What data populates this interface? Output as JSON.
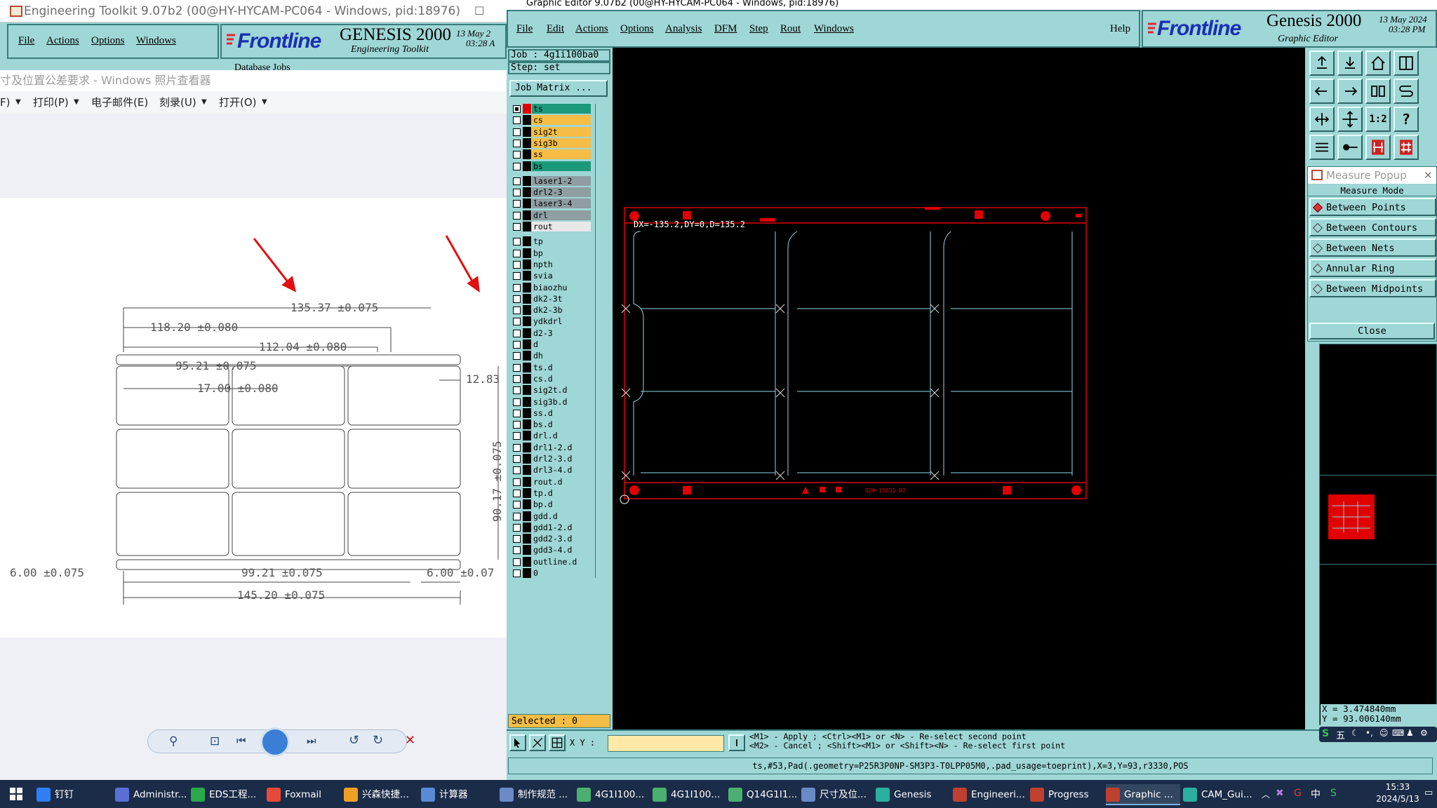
{
  "toolkit": {
    "title": "Engineering Toolkit 9.07b2 (00@HY-HYCAM-PC064 - Windows, pid:18976)",
    "menu": [
      "File",
      "Actions",
      "Options",
      "Windows"
    ],
    "brand": "Frontline",
    "genesis": "GENESIS 2000",
    "date": "13 May 2",
    "time": "03:28 A",
    "subtitle": "Engineering Toolkit",
    "database_jobs": "Database Jobs"
  },
  "viewer": {
    "title": "寸及位置公差要求 - Windows 照片查看器",
    "menu": [
      {
        "label": "F)"
      },
      {
        "label": "打印(P)"
      },
      {
        "label": "电子邮件(E)"
      },
      {
        "label": "刻录(U)"
      },
      {
        "label": "打开(O)"
      }
    ],
    "drawing": {
      "dims": [
        "135.37 ±0.075",
        "118.20 ±0.080",
        "112.04 ±0.080",
        "95.21 ±0.075",
        "17.00 ±0.080",
        "12.83",
        "90.17 ±0.075",
        "6.00 ±0.075",
        "99.21 ±0.075",
        "6.00 ±0.07",
        "145.20 ±0.075"
      ]
    }
  },
  "editor": {
    "title": "Graphic Editor 9.07b2 (00@HY-HYCAM-PC064 - Windows, pid:18976)",
    "menu": [
      "File",
      "Edit",
      "Actions",
      "Options",
      "Analysis",
      "DFM",
      "Step",
      "Rout",
      "Windows"
    ],
    "help": "Help",
    "brand": "Frontline",
    "genesis": "Genesis 2000",
    "date": "13 May 2024",
    "time": "03:28 PM",
    "subtitle": "Graphic Editor",
    "job_label": "Job : 4g1i100ba0",
    "step_label": "Step: set",
    "job_matrix": "Job Matrix ...",
    "layers": [
      {
        "name": "ts",
        "color": "#1a9a7a"
      },
      {
        "name": "cs",
        "color": "#f5bd45"
      },
      {
        "name": "sig2t",
        "color": "#f5bd45"
      },
      {
        "name": "sig3b",
        "color": "#f5bd45"
      },
      {
        "name": "ss",
        "color": "#f5bd45"
      },
      {
        "name": "bs",
        "color": "#1a9a7a"
      },
      {
        "name": "laser1-2",
        "color": "#8e9ea3"
      },
      {
        "name": "drl2-3",
        "color": "#8e9ea3"
      },
      {
        "name": "laser3-4",
        "color": "#8e9ea3"
      },
      {
        "name": "drl",
        "color": "#8e9ea3"
      },
      {
        "name": "rout",
        "color": "#e8e8e8"
      },
      {
        "name": "tp",
        "color": "#9fd6d6"
      },
      {
        "name": "bp",
        "color": "#9fd6d6"
      },
      {
        "name": "npth",
        "color": "#9fd6d6"
      },
      {
        "name": "svia",
        "color": "#9fd6d6"
      },
      {
        "name": "biaozhu",
        "color": "#9fd6d6"
      },
      {
        "name": "dk2-3t",
        "color": "#9fd6d6"
      },
      {
        "name": "dk2-3b",
        "color": "#9fd6d6"
      },
      {
        "name": "ydkdrl",
        "color": "#9fd6d6"
      },
      {
        "name": "d2-3",
        "color": "#9fd6d6"
      },
      {
        "name": "d",
        "color": "#9fd6d6"
      },
      {
        "name": "dh",
        "color": "#9fd6d6"
      },
      {
        "name": "ts.d",
        "color": "#9fd6d6"
      },
      {
        "name": "cs.d",
        "color": "#9fd6d6"
      },
      {
        "name": "sig2t.d",
        "color": "#9fd6d6"
      },
      {
        "name": "sig3b.d",
        "color": "#9fd6d6"
      },
      {
        "name": "ss.d",
        "color": "#9fd6d6"
      },
      {
        "name": "bs.d",
        "color": "#9fd6d6"
      },
      {
        "name": "drl.d",
        "color": "#9fd6d6"
      },
      {
        "name": "drl1-2.d",
        "color": "#9fd6d6"
      },
      {
        "name": "drl2-3.d",
        "color": "#9fd6d6"
      },
      {
        "name": "drl3-4.d",
        "color": "#9fd6d6"
      },
      {
        "name": "rout.d",
        "color": "#9fd6d6"
      },
      {
        "name": "tp.d",
        "color": "#9fd6d6"
      },
      {
        "name": "bp.d",
        "color": "#9fd6d6"
      },
      {
        "name": "gdd.d",
        "color": "#9fd6d6"
      },
      {
        "name": "gdd1-2.d",
        "color": "#9fd6d6"
      },
      {
        "name": "gdd2-3.d",
        "color": "#9fd6d6"
      },
      {
        "name": "gdd3-4.d",
        "color": "#9fd6d6"
      },
      {
        "name": "outline.d",
        "color": "#9fd6d6"
      },
      {
        "name": "0",
        "color": "#9fd6d6"
      }
    ],
    "selected": "Selected : 0",
    "canvas_readout": "DX=-135.2,DY=0,D=135.2",
    "panel_text": "920-15631-02",
    "xy_label": "X Y :",
    "hint1": "<M1> - Apply  ; <Ctrl><M1> or <N> - Re-select second point",
    "hint2": "<M2> - Cancel ; <Shift><M1> or <Shift><N> - Re-select first point",
    "status": "ts,#53,Pad(.geometry=P25R3P0NP-SM3P3-T0LPP05M0,.pad_usage=toeprint),X=3,Y=93,r3330,POS",
    "coord_x": "X = 3.474840mm",
    "coord_y": "Y = 93.006140mm",
    "measure": {
      "title": "Measure Popup",
      "mode": "Measure Mode",
      "items": [
        "Between Points",
        "Between Contours",
        "Between Nets",
        "Annular Ring",
        "Between Midpoints"
      ],
      "close": "Close"
    }
  },
  "taskbar": {
    "items": [
      {
        "label": "钉钉",
        "color": "#2f7ef5"
      },
      {
        "label": "Administr...",
        "color": "#5a6fd6"
      },
      {
        "label": "EDS工程...",
        "color": "#2aa84a"
      },
      {
        "label": "Foxmail",
        "color": "#e84a3a"
      },
      {
        "label": "兴森快捷...",
        "color": "#f0a020"
      },
      {
        "label": "计算器",
        "color": "#5a8ad6"
      },
      {
        "label": "制作规范 ...",
        "color": "#6a8ac6"
      },
      {
        "label": "4G1I100...",
        "color": "#4ab070"
      },
      {
        "label": "4G1I100...",
        "color": "#4ab070"
      },
      {
        "label": "Q14G1I1...",
        "color": "#4ab070"
      },
      {
        "label": "尺寸及位...",
        "color": "#6a8ac6"
      },
      {
        "label": "Genesis",
        "color": "#2ab0a0"
      },
      {
        "label": "Engineeri...",
        "color": "#c04030"
      },
      {
        "label": "Progress",
        "color": "#c04030"
      },
      {
        "label": "Graphic ...",
        "color": "#c04030"
      },
      {
        "label": "CAM_Gui...",
        "color": "#2ab0a0"
      }
    ],
    "tray_text": "中",
    "ime_text": "五",
    "time": "15:33",
    "date": "2024/5/13"
  }
}
